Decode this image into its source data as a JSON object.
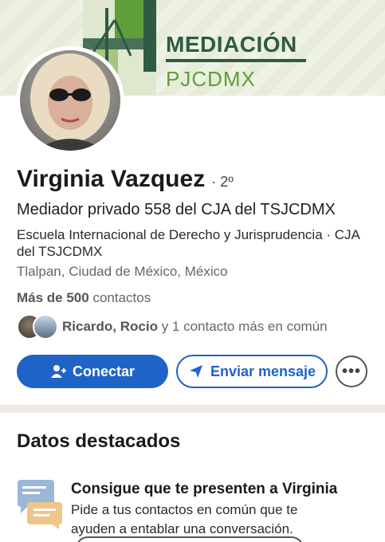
{
  "banner": {
    "title": "MEDIACIÓN",
    "subtitle": "PJCDMX"
  },
  "profile": {
    "name": "Virginia Vazquez",
    "degree": "· 2º",
    "headline": "Mediador privado 558 del CJA del TSJCDMX",
    "education": "Escuela Internacional de Derecho y Jurisprudencia · CJA del TSJCDMX",
    "location": "Tlalpan, Ciudad de México, México",
    "connections_count": "Más de 500",
    "connections_label": "contactos",
    "mutual_names": "Ricardo, Rocio",
    "mutual_rest": "y 1 contacto más en común"
  },
  "actions": {
    "connect_label": "Conectar",
    "message_label": "Enviar mensaje",
    "more_label": "•••"
  },
  "highlights": {
    "section_title": "Datos destacados",
    "item_title": "Consigue que te presenten a Virginia",
    "item_description": "Pide a tus contactos en común que te ayuden a entablar una conversación."
  },
  "colors": {
    "primary": "#1f63c6",
    "banner_green": "#2f5a44",
    "banner_light_green": "#5f9e39"
  }
}
